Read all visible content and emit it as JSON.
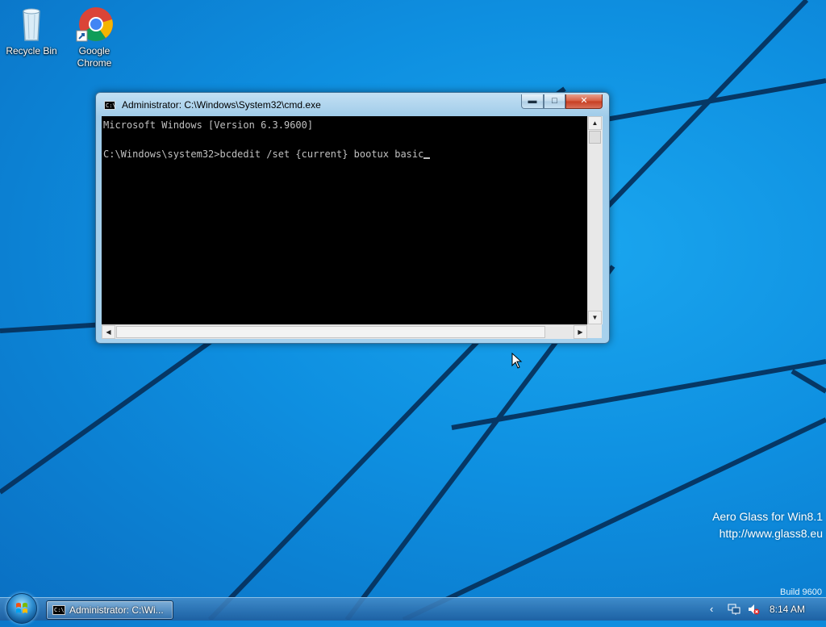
{
  "desktop": {
    "icons": [
      {
        "label": "Recycle Bin",
        "icon": "recycle-bin-icon"
      },
      {
        "label": "Google\nChrome",
        "icon": "chrome-icon"
      }
    ]
  },
  "cmd": {
    "title": "Administrator: C:\\Windows\\System32\\cmd.exe",
    "icon_text": "C:\\",
    "lines": [
      "Microsoft Windows [Version 6.3.9600]",
      "",
      "C:\\Windows\\system32>bcdedit /set {current} bootux basic"
    ],
    "buttons": {
      "minimize": "minimize-icon",
      "maximize": "maximize-icon",
      "close": "close-icon"
    }
  },
  "watermark": {
    "line1": "Aero Glass for Win8.1",
    "line2": "http://www.glass8.eu",
    "build": "Build 9600"
  },
  "taskbar": {
    "task_label": "Administrator: C:\\Wi...",
    "task_icon_text": "C:\\",
    "clock": "8:14 AM",
    "tray_icons": [
      "chevron-left-icon",
      "network-icon",
      "volume-muted-icon"
    ]
  },
  "colors": {
    "desktop_blue": "#0e8fe0",
    "console_bg": "#000000",
    "console_fg": "#c0c0c0",
    "close_red": "#c63d20"
  }
}
